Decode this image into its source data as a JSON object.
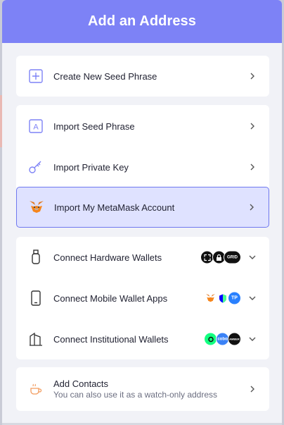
{
  "header": {
    "title": "Add an Address"
  },
  "group1": {
    "items": [
      {
        "label": "Create New Seed Phrase",
        "icon": "plus-square-icon"
      }
    ]
  },
  "group2": {
    "items": [
      {
        "label": "Import Seed Phrase",
        "icon": "letter-a-icon"
      },
      {
        "label": "Import Private Key",
        "icon": "key-icon"
      },
      {
        "label": "Import My MetaMask Account",
        "icon": "metamask-fox-icon"
      }
    ]
  },
  "group3": {
    "items": [
      {
        "label": "Connect Hardware Wallets",
        "icon": "usb-device-icon",
        "badges": [
          "ledger",
          "lock",
          "GRID"
        ]
      },
      {
        "label": "Connect Mobile Wallet Apps",
        "icon": "mobile-phone-icon",
        "badges": [
          "metamask",
          "trust",
          "TP"
        ]
      },
      {
        "label": "Connect Institutional Wallets",
        "icon": "building-icon",
        "badges": [
          "gnosis",
          "cobo",
          "amber"
        ]
      }
    ]
  },
  "group4": {
    "items": [
      {
        "label": "Add Contacts",
        "sublabel": "You can also use it as a watch-only address",
        "icon": "coffee-cup-icon"
      }
    ]
  },
  "badge_text": {
    "tp": "TP",
    "grid": "GRID",
    "cobo": "cobo",
    "amber": "AMBER"
  },
  "colors": {
    "header": "#7d82f6",
    "accent": "#6f78ef",
    "highlight": "#dfe2ff",
    "background": "#f1f2f7"
  }
}
